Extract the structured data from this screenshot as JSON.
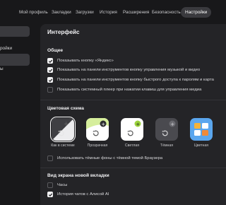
{
  "nav": {
    "tabs": [
      {
        "label": "Мой профиль",
        "active": false
      },
      {
        "label": "Закладки",
        "active": false
      },
      {
        "label": "Загрузки",
        "active": false
      },
      {
        "label": "История",
        "active": false
      },
      {
        "label": "Расширения",
        "active": false
      },
      {
        "label": "Безопасность",
        "active": false
      },
      {
        "label": "Настройки",
        "active": true
      }
    ]
  },
  "sidebar": {
    "items": [
      {
        "label": "ройки"
      },
      {
        "label": "ы"
      }
    ]
  },
  "interface": {
    "title": "Интерфейс",
    "general": {
      "heading": "Общее",
      "options": [
        {
          "label": "Показывать кнопку «Яндекс»",
          "checked": true
        },
        {
          "label": "Показывать на панели инструментов кнопку управления музыкой и видео",
          "checked": true
        },
        {
          "label": "Показывать на панели инструментов кнопку быстрого доступа к паролям и карта",
          "checked": true
        },
        {
          "label": "Показывать системный плеер при нажатии клавиш для управления медиа",
          "checked": false
        }
      ]
    },
    "color_scheme": {
      "heading": "Цветовая схема",
      "themes": [
        {
          "label": "Как в системе",
          "icon": "system-theme-icon",
          "selected": true
        },
        {
          "label": "Прозрачная",
          "icon": "transparent-theme-icon",
          "selected": false
        },
        {
          "label": "Светлая",
          "icon": "light-theme-icon",
          "selected": false
        },
        {
          "label": "Тёмная",
          "icon": "dark-theme-icon",
          "selected": false
        },
        {
          "label": "Цветная",
          "icon": "colored-theme-icon",
          "selected": false
        }
      ],
      "dark_backgrounds": {
        "label": "Использовать тёмные фоны с тёмной темой Браузера",
        "checked": false
      }
    },
    "new_tab": {
      "heading": "Вид экрана новой вкладки",
      "options": [
        {
          "label": "Часы",
          "checked": false
        },
        {
          "label": "История чатов с Алисой AI",
          "checked": true
        }
      ]
    }
  },
  "colors": {
    "background": "#18181a",
    "panel": "#242427",
    "active_tab": "#3a3a3e",
    "selection_accent": "#ffffff",
    "light_theme_green": "#9bd33c"
  }
}
